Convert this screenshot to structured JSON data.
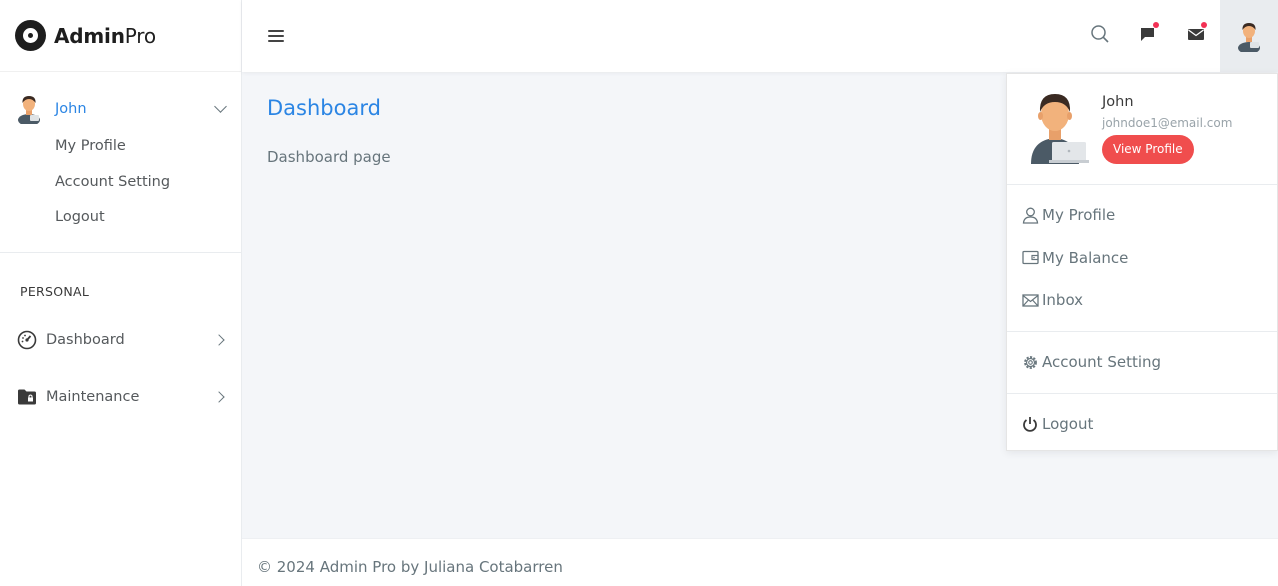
{
  "brand": {
    "name_bold": "Admin",
    "name_light": "Pro"
  },
  "sidebar": {
    "user": {
      "name": "John"
    },
    "user_links": [
      {
        "label": "My Profile"
      },
      {
        "label": "Account Setting"
      },
      {
        "label": "Logout"
      }
    ],
    "section_label": "PERSONAL",
    "nav": [
      {
        "label": "Dashboard",
        "icon": "dashboard-gauge-icon"
      },
      {
        "label": "Maintenance",
        "icon": "folder-lock-icon"
      }
    ]
  },
  "topbar": {
    "icons": [
      "menu-icon",
      "search-icon",
      "message-flag-icon",
      "mail-icon",
      "user-avatar"
    ],
    "notification_dot_color": "#f33155"
  },
  "main": {
    "title": "Dashboard",
    "text": "Dashboard page"
  },
  "dropdown": {
    "name": "John",
    "email": "johndoe1@email.com",
    "view_profile_label": "View Profile",
    "items": [
      {
        "label": "My Profile",
        "icon": "user-icon"
      },
      {
        "label": "My Balance",
        "icon": "wallet-icon"
      },
      {
        "label": "Inbox",
        "icon": "envelope-icon"
      },
      {
        "label": "Account Setting",
        "icon": "gear-icon"
      },
      {
        "label": "Logout",
        "icon": "power-icon"
      }
    ]
  },
  "footer": {
    "text": "© 2024 Admin Pro by Juliana Cotabarren"
  },
  "colors": {
    "accent": "#2b85e4",
    "button": "#f04d4d",
    "background": "#f4f6f9"
  }
}
